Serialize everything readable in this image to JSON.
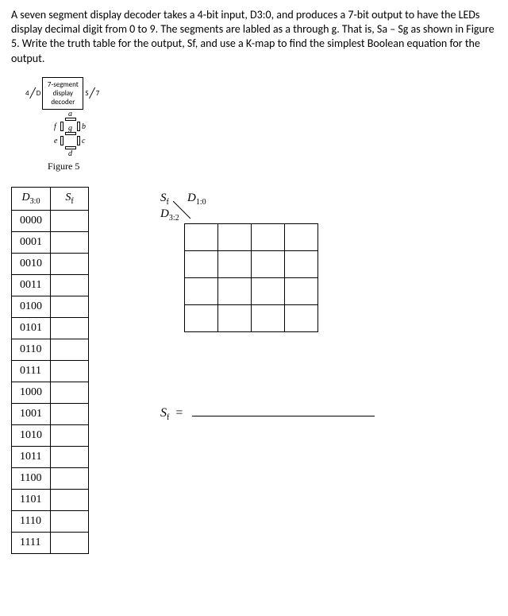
{
  "problem": {
    "text": "A seven segment display decoder takes a 4-bit input, D3:0, and produces a 7-bit output to have the LEDs display decimal digit from 0 to 9. The segments are labled as a through g. That is, Sa – Sg as shown in Figure 5. Write the truth table for the output, Sf, and use a K-map to find the simplest Boolean equation for the output."
  },
  "figure": {
    "block_line1": "7-segment",
    "block_line2": "display",
    "block_line3": "decoder",
    "in_bits": "4",
    "in_label": "D",
    "out_label": "S",
    "out_bits": "7",
    "segments": {
      "a": "a",
      "b": "b",
      "c": "c",
      "d": "d",
      "e": "e",
      "f": "f",
      "g": "g"
    },
    "caption": "Figure 5"
  },
  "truth_table": {
    "col1_base": "D",
    "col1_sub": "3:0",
    "col2_base": "S",
    "col2_sub": "f",
    "rows": [
      "0000",
      "0001",
      "0010",
      "0011",
      "0100",
      "0101",
      "0110",
      "0111",
      "1000",
      "1001",
      "1010",
      "1011",
      "1100",
      "1101",
      "1110",
      "1111"
    ]
  },
  "kmap": {
    "top_left_base": "S",
    "top_left_sub": "f",
    "col_base": "D",
    "col_sub": "1:0",
    "row_base": "D",
    "row_sub": "3:2"
  },
  "equation": {
    "lhs_base": "S",
    "lhs_sub": "f",
    "eq": "="
  }
}
